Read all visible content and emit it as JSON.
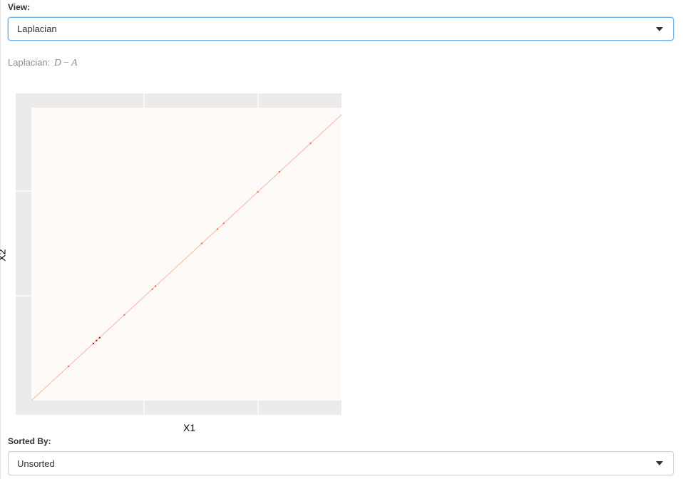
{
  "view_control": {
    "label": "View:",
    "selected": "Laplacian"
  },
  "formula": {
    "prefix": "Laplacian:",
    "expression": {
      "left": "D",
      "operator": "−",
      "right": "A"
    }
  },
  "sort_control": {
    "label": "Sorted By:",
    "selected": "Unsorted"
  },
  "chart_data": {
    "type": "heatmap",
    "title": "",
    "xlabel": "X1",
    "ylabel": "X2",
    "grid": true,
    "description_values": {
      "background_value": 0,
      "diagonal": "nonzero diagonal entries from bottom-left to top-right",
      "dense_cluster_fraction_along_diagonal": 0.2
    },
    "colors": {
      "low": "#fdfaf7",
      "mid": "#ffb3a0",
      "high": "#b30000",
      "panel": "#ebebeb"
    }
  }
}
